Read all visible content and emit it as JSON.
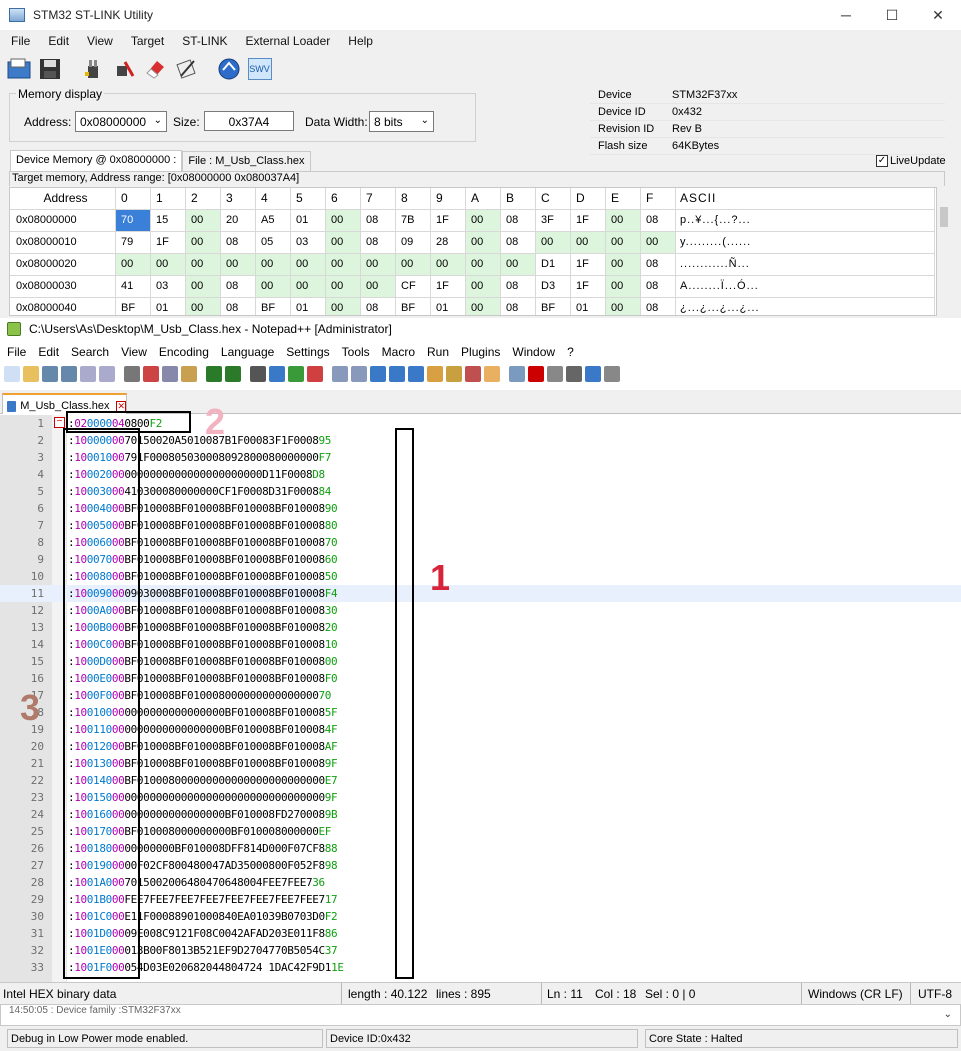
{
  "stlink": {
    "title": "STM32 ST-LINK Utility",
    "window_controls": {
      "minimize": "─",
      "maximize": "☐",
      "close": "✕"
    },
    "menu": [
      "File",
      "Edit",
      "View",
      "Target",
      "ST-LINK",
      "External Loader",
      "Help"
    ],
    "toolbar_icons": [
      "open-file-icon",
      "save-icon",
      "connect-icon",
      "disconnect-icon",
      "erase-icon",
      "program-verify-icon",
      "mcu-core-icon",
      "swv-icon"
    ],
    "swv_label": "SWV",
    "memory_display": {
      "group_title": "Memory display",
      "address_label": "Address:",
      "address_value": "0x08000000",
      "size_label": "Size:",
      "size_value": "0x37A4",
      "width_label": "Data Width:",
      "width_value": "8 bits"
    },
    "device_info": [
      {
        "key": "Device",
        "value": "STM32F37xx"
      },
      {
        "key": "Device ID",
        "value": "0x432"
      },
      {
        "key": "Revision ID",
        "value": "Rev B"
      },
      {
        "key": "Flash size",
        "value": "64KBytes"
      }
    ],
    "tabs": [
      "Device Memory @ 0x08000000 :",
      "File : M_Usb_Class.hex"
    ],
    "live_update": "LiveUpdate",
    "range_text": "Target memory, Address range: [0x08000000 0x080037A4]",
    "grid_headers": [
      "Address",
      "0",
      "1",
      "2",
      "3",
      "4",
      "5",
      "6",
      "7",
      "8",
      "9",
      "A",
      "B",
      "C",
      "D",
      "E",
      "F",
      "ASCII"
    ],
    "grid_rows": [
      {
        "addr": "0x08000000",
        "bytes": [
          "70",
          "15",
          "00",
          "20",
          "A5",
          "01",
          "00",
          "08",
          "7B",
          "1F",
          "00",
          "08",
          "3F",
          "1F",
          "00",
          "08"
        ],
        "ascii": "p..¥...{...?..."
      },
      {
        "addr": "0x08000010",
        "bytes": [
          "79",
          "1F",
          "00",
          "08",
          "05",
          "03",
          "00",
          "08",
          "09",
          "28",
          "00",
          "08",
          "00",
          "00",
          "00",
          "00"
        ],
        "ascii": "y.........(......"
      },
      {
        "addr": "0x08000020",
        "bytes": [
          "00",
          "00",
          "00",
          "00",
          "00",
          "00",
          "00",
          "00",
          "00",
          "00",
          "00",
          "00",
          "D1",
          "1F",
          "00",
          "08"
        ],
        "ascii": "............Ñ..."
      },
      {
        "addr": "0x08000030",
        "bytes": [
          "41",
          "03",
          "00",
          "08",
          "00",
          "00",
          "00",
          "00",
          "CF",
          "1F",
          "00",
          "08",
          "D3",
          "1F",
          "00",
          "08"
        ],
        "ascii": "A........Ï...Ó..."
      },
      {
        "addr": "0x08000040",
        "bytes": [
          "BF",
          "01",
          "00",
          "08",
          "BF",
          "01",
          "00",
          "08",
          "BF",
          "01",
          "00",
          "08",
          "BF",
          "01",
          "00",
          "08"
        ],
        "ascii": "¿...¿...¿...¿..."
      }
    ]
  },
  "npp": {
    "title": "C:\\Users\\As\\Desktop\\M_Usb_Class.hex - Notepad++ [Administrator]",
    "menu": [
      "File",
      "Edit",
      "Search",
      "View",
      "Encoding",
      "Language",
      "Settings",
      "Tools",
      "Macro",
      "Run",
      "Plugins",
      "Window",
      "?"
    ],
    "tab": "M_Usb_Class.hex",
    "lines": [
      {
        "n": "1",
        "len": "02",
        "addr": "0000",
        "type": "04",
        "data": "0800",
        "sum": "F2"
      },
      {
        "n": "2",
        "len": "10",
        "addr": "0000",
        "type": "00",
        "data": "70150020A5010087B1F00083F1F0008",
        "sum": "95"
      },
      {
        "n": "3",
        "len": "10",
        "addr": "0010",
        "type": "00",
        "data": "791F000805030008092800080000000",
        "sum": "F7"
      },
      {
        "n": "4",
        "len": "10",
        "addr": "0020",
        "type": "00",
        "data": "0000000000000000000000D11F0008",
        "sum": "D8"
      },
      {
        "n": "5",
        "len": "10",
        "addr": "0030",
        "type": "00",
        "data": "410300080000000CF1F0008D31F0008",
        "sum": "84"
      },
      {
        "n": "6",
        "len": "10",
        "addr": "0040",
        "type": "00",
        "data": "BF010008BF010008BF010008BF010008",
        "sum": "90"
      },
      {
        "n": "7",
        "len": "10",
        "addr": "0050",
        "type": "00",
        "data": "BF010008BF010008BF010008BF010008",
        "sum": "80"
      },
      {
        "n": "8",
        "len": "10",
        "addr": "0060",
        "type": "00",
        "data": "BF010008BF010008BF010008BF010008",
        "sum": "70"
      },
      {
        "n": "9",
        "len": "10",
        "addr": "0070",
        "type": "00",
        "data": "BF010008BF010008BF010008BF010008",
        "sum": "60"
      },
      {
        "n": "10",
        "len": "10",
        "addr": "0080",
        "type": "00",
        "data": "BF010008BF010008BF010008BF010008",
        "sum": "50"
      },
      {
        "n": "11",
        "len": "10",
        "addr": "0090",
        "type": "00",
        "data": "09030008BF010008BF010008BF010008",
        "sum": "F4"
      },
      {
        "n": "12",
        "len": "10",
        "addr": "00A0",
        "type": "00",
        "data": "BF010008BF010008BF010008BF010008",
        "sum": "30"
      },
      {
        "n": "13",
        "len": "10",
        "addr": "00B0",
        "type": "00",
        "data": "BF010008BF010008BF010008BF010008",
        "sum": "20"
      },
      {
        "n": "14",
        "len": "10",
        "addr": "00C0",
        "type": "00",
        "data": "BF010008BF010008BF010008BF010008",
        "sum": "10"
      },
      {
        "n": "15",
        "len": "10",
        "addr": "00D0",
        "type": "00",
        "data": "BF010008BF010008BF010008BF010008",
        "sum": "00"
      },
      {
        "n": "16",
        "len": "10",
        "addr": "00E0",
        "type": "00",
        "data": "BF010008BF010008BF010008BF010008",
        "sum": "F0"
      },
      {
        "n": "17",
        "len": "10",
        "addr": "00F0",
        "type": "00",
        "data": "BF010008BF010008000000000000000",
        "sum": "70"
      },
      {
        "n": "18",
        "len": "10",
        "addr": "0100",
        "type": "00",
        "data": "0000000000000000BF010008BF010008",
        "sum": "5F"
      },
      {
        "n": "19",
        "len": "10",
        "addr": "0110",
        "type": "00",
        "data": "0000000000000000BF010008BF010008",
        "sum": "4F"
      },
      {
        "n": "20",
        "len": "10",
        "addr": "0120",
        "type": "00",
        "data": "BF010008BF010008BF010008BF010008",
        "sum": "AF"
      },
      {
        "n": "21",
        "len": "10",
        "addr": "0130",
        "type": "00",
        "data": "BF010008BF010008BF010008BF010008",
        "sum": "9F"
      },
      {
        "n": "22",
        "len": "10",
        "addr": "0140",
        "type": "00",
        "data": "BF010008000000000000000000000000",
        "sum": "E7"
      },
      {
        "n": "23",
        "len": "10",
        "addr": "0150",
        "type": "00",
        "data": "00000000000000000000000000000000",
        "sum": "9F"
      },
      {
        "n": "24",
        "len": "10",
        "addr": "0160",
        "type": "00",
        "data": "0000000000000000BF010008FD270008",
        "sum": "9B"
      },
      {
        "n": "25",
        "len": "10",
        "addr": "0170",
        "type": "00",
        "data": "BF010008000000000BF010008000000",
        "sum": "EF"
      },
      {
        "n": "26",
        "len": "10",
        "addr": "0180",
        "type": "00",
        "data": "00000000BF010008DFF814D000F07CF8",
        "sum": "88"
      },
      {
        "n": "27",
        "len": "10",
        "addr": "0190",
        "type": "00",
        "data": "00F02CF800480047AD35000800F052F8",
        "sum": "98"
      },
      {
        "n": "28",
        "len": "10",
        "addr": "01A0",
        "type": "00",
        "data": "7015002006480470648004FEE7FEE7",
        "sum": "36"
      },
      {
        "n": "29",
        "len": "10",
        "addr": "01B0",
        "type": "00",
        "data": "FEE7FEE7FEE7FEE7FEE7FEE7FEE7FEE7",
        "sum": "17"
      },
      {
        "n": "30",
        "len": "10",
        "addr": "01C0",
        "type": "00",
        "data": "E11F00088901000840EA01039B0703D0",
        "sum": "F2"
      },
      {
        "n": "31",
        "len": "10",
        "addr": "01D0",
        "type": "00",
        "data": "09E008C9121F08C0042AFAD203E011F8",
        "sum": "86"
      },
      {
        "n": "32",
        "len": "10",
        "addr": "01E0",
        "type": "00",
        "data": "013B00F8013B521EF9D2704770B5054C",
        "sum": "37"
      },
      {
        "n": "33",
        "len": "10",
        "addr": "01F0",
        "type": "00",
        "data": "054D03E020682044804724 1DAC42F9D1",
        "sum": "1E"
      }
    ],
    "annotations": {
      "one": "1",
      "two": "2",
      "three": "3"
    },
    "status": {
      "type": "Intel HEX binary data",
      "length": "length : 40.122",
      "lines": "lines : 895",
      "ln": "Ln : 11",
      "col": "Col : 18",
      "sel": "Sel : 0 | 0",
      "eol": "Windows (CR LF)",
      "encoding": "UTF-8"
    }
  },
  "bottom": {
    "log_line": "14:50:05 : Device family :STM32F37xx",
    "status1": "Debug in Low Power mode enabled.",
    "status2": "Device ID:0x432",
    "status3": "Core State : Halted"
  }
}
